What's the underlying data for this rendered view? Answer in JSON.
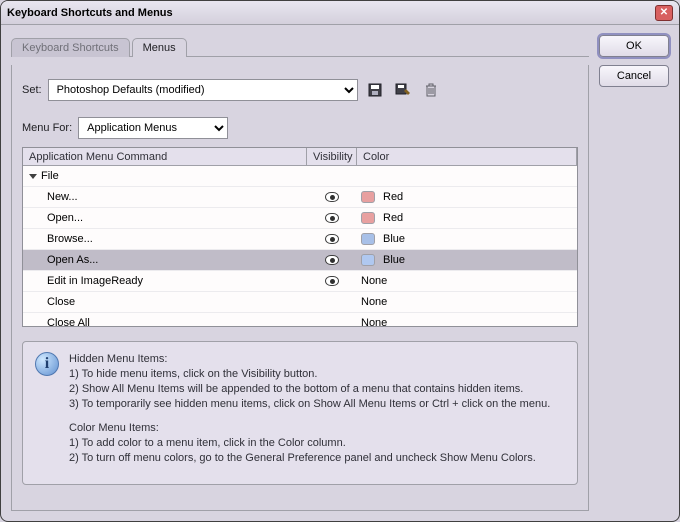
{
  "window": {
    "title": "Keyboard Shortcuts and Menus"
  },
  "buttons": {
    "ok": "OK",
    "cancel": "Cancel"
  },
  "tabs": {
    "shortcuts": "Keyboard Shortcuts",
    "menus": "Menus"
  },
  "set": {
    "label": "Set:",
    "value": "Photoshop Defaults (modified)",
    "icons": {
      "save": "save-icon",
      "save_as": "save-as-icon",
      "delete": "trash-icon"
    }
  },
  "menuFor": {
    "label": "Menu For:",
    "value": "Application Menus"
  },
  "grid": {
    "headers": {
      "command": "Application Menu Command",
      "visibility": "Visibility",
      "color": "Color"
    },
    "group": "File",
    "rows": [
      {
        "command": "New...",
        "visible": true,
        "colorName": "Red",
        "swatch": "red",
        "selected": false
      },
      {
        "command": "Open...",
        "visible": true,
        "colorName": "Red",
        "swatch": "red",
        "selected": false
      },
      {
        "command": "Browse...",
        "visible": true,
        "colorName": "Blue",
        "swatch": "blue",
        "selected": false
      },
      {
        "command": "Open As...",
        "visible": true,
        "colorName": "Blue",
        "swatch": "selblue",
        "selected": true
      },
      {
        "command": "Edit in ImageReady",
        "visible": true,
        "colorName": "None",
        "swatch": "",
        "selected": false
      },
      {
        "command": "Close",
        "visible": false,
        "colorName": "None",
        "swatch": "",
        "selected": false
      },
      {
        "command": "Close All",
        "visible": false,
        "colorName": "None",
        "swatch": "",
        "selected": false
      }
    ]
  },
  "info": {
    "hidden_title": "Hidden Menu Items:",
    "hidden_1": "1) To hide menu items, click on the Visibility button.",
    "hidden_2": "2) Show All Menu Items will be appended to the bottom of a menu that contains hidden items.",
    "hidden_3": "3) To temporarily see hidden menu items, click on Show All Menu Items or Ctrl + click on the menu.",
    "color_title": "Color Menu Items:",
    "color_1": "1) To add color to a menu item, click in the Color column.",
    "color_2": "2) To turn off menu colors, go to the General Preference panel and uncheck Show Menu Colors."
  }
}
